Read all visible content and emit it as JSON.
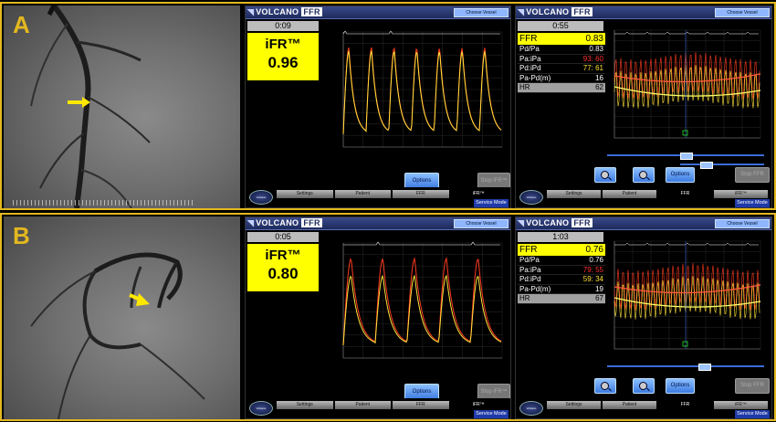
{
  "panels": [
    {
      "letter": "A",
      "left_screen": {
        "logo": "VOLCANO",
        "logo_ffr": "FFR",
        "choose_vessel": "Choose Vessel",
        "timer": "0:09",
        "ifr_label": "iFR™",
        "ifr_value": "0.96",
        "options_label": "Options",
        "disabled_label": "Stop iFR™",
        "tabs": [
          "Settings",
          "Patient",
          "FFR",
          "iFR™"
        ],
        "service_mode": "Service Mode",
        "home_label": "Volcano"
      },
      "right_screen": {
        "logo": "VOLCANO",
        "logo_ffr": "FFR",
        "choose_vessel": "Choose Vessel",
        "timer": "0:55",
        "ffr_label": "FFR",
        "ffr_value": "0.83",
        "rows": [
          {
            "label": "Pd/Pa",
            "value": "0.83"
          },
          {
            "label": "Pa:iPa",
            "value": "93: 60"
          },
          {
            "label": "Pd:iPd",
            "value": "77: 61"
          },
          {
            "label": "Pa-Pd(m)",
            "value": "16"
          },
          {
            "label": "HR",
            "value": "62"
          }
        ],
        "options_label": "Options",
        "disabled_label": "Stop FFR",
        "tabs": [
          "Settings",
          "Patient",
          "FFR",
          "iFR™"
        ],
        "service_mode": "Service Mode",
        "home_label": "Volcano"
      }
    },
    {
      "letter": "B",
      "left_screen": {
        "logo": "VOLCANO",
        "logo_ffr": "FFR",
        "choose_vessel": "Choose Vessel",
        "timer": "0:05",
        "ifr_label": "iFR™",
        "ifr_value": "0.80",
        "options_label": "Options",
        "disabled_label": "Stop iFR™",
        "tabs": [
          "Settings",
          "Patient",
          "FFR",
          "iFR™"
        ],
        "service_mode": "Service Mode",
        "home_label": "Volcano"
      },
      "right_screen": {
        "logo": "VOLCANO",
        "logo_ffr": "FFR",
        "choose_vessel": "Choose Vessel",
        "timer": "1:03",
        "ffr_label": "FFR",
        "ffr_value": "0.76",
        "rows": [
          {
            "label": "Pd/Pa",
            "value": "0.76"
          },
          {
            "label": "Pa:iPa",
            "value": "79: 55"
          },
          {
            "label": "Pd:iPd",
            "value": "59: 34"
          },
          {
            "label": "Pa-Pd(m)",
            "value": "19"
          },
          {
            "label": "HR",
            "value": "67"
          }
        ],
        "options_label": "Options",
        "disabled_label": "Stop FFR",
        "tabs": [
          "Settings",
          "Patient",
          "FFR",
          "iFR™"
        ],
        "service_mode": "Service Mode",
        "home_label": "Volcano"
      }
    }
  ],
  "colors": {
    "frame": "#e3b81f",
    "highlight": "#ffff00",
    "pa_trace": "#ff3b1f",
    "pd_trace": "#ffe23a",
    "ecg_trace": "#ffffff",
    "button": "#3d7be0"
  },
  "icons": [
    "arrow-icon",
    "zoom-out-icon",
    "zoom-in-icon",
    "home-button-icon"
  ]
}
